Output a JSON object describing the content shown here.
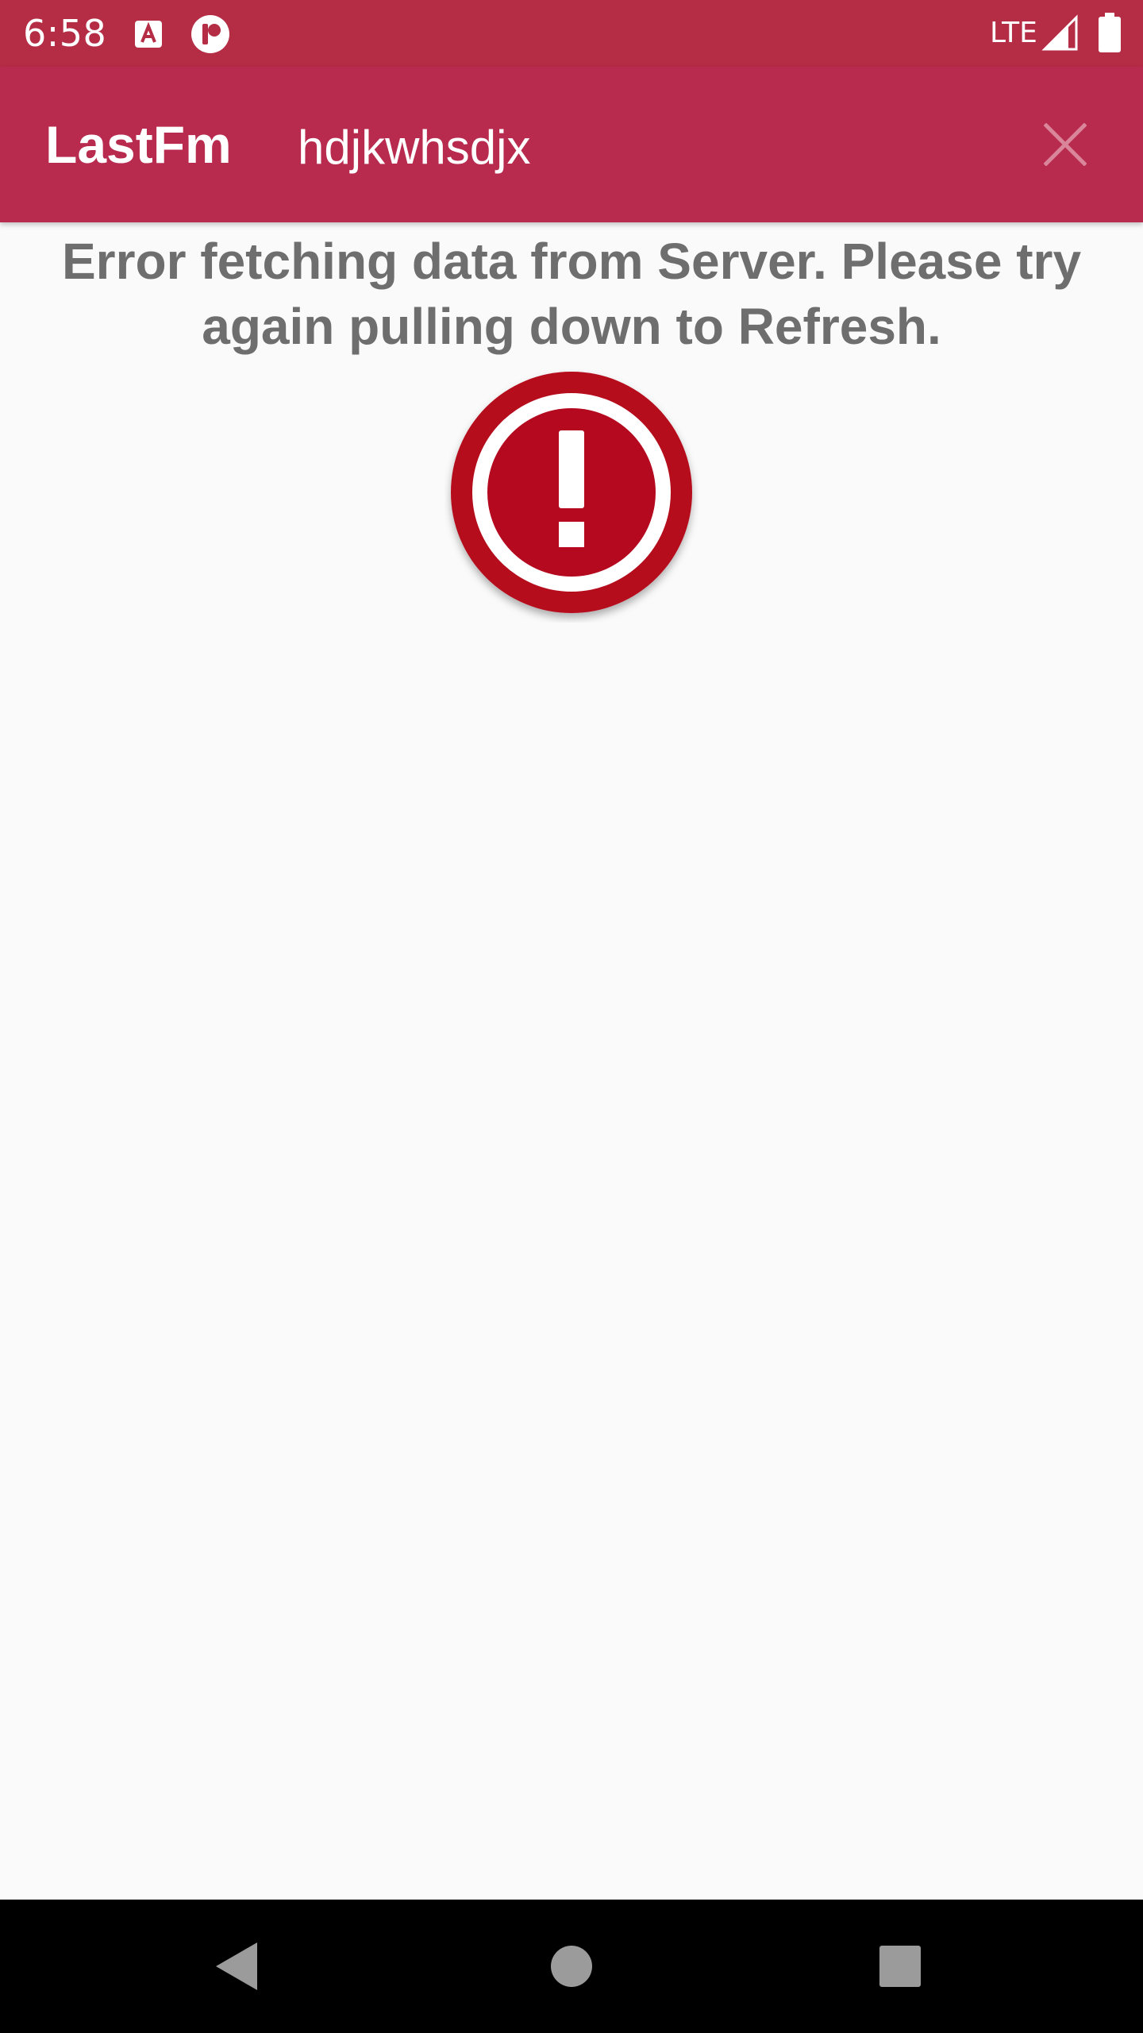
{
  "status_bar": {
    "time": "6:58",
    "network": "LTE",
    "icons": [
      "text-a-icon",
      "notification-app-icon",
      "signal-icon",
      "battery-icon"
    ]
  },
  "app_bar": {
    "title": "LastFm",
    "search_value": "hdjkwhsdjx",
    "close_icon": "close-icon"
  },
  "content": {
    "error_message": "Error fetching data from Server. Please try again pulling down to Refresh.",
    "error_icon": "error-alert-icon"
  },
  "nav_bar": {
    "icons": [
      "back-icon",
      "home-icon",
      "recents-icon"
    ]
  },
  "colors": {
    "status_bar": "#b52c45",
    "app_bar": "#b82b4e",
    "error_red": "#b5091f",
    "error_text": "#6e6e6e",
    "background": "#fafafa"
  }
}
